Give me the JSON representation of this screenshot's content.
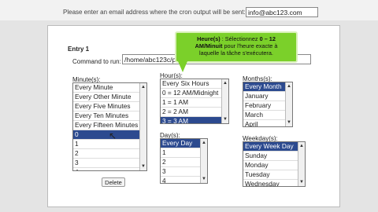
{
  "email": {
    "label": "Please enter an email address where the cron output will be sent:",
    "value": "info@abc123.com"
  },
  "entry": {
    "title": "Entry 1",
    "command_label": "Command to run:",
    "command_value": "/home/abc123c/pi"
  },
  "minute": {
    "label": "Minute(s):",
    "items": [
      "Every Minute",
      "Every Other Minute",
      "Every Five Minutes",
      "Every Ten Minutes",
      "Every Fifteen Minutes",
      "0",
      "1",
      "2",
      "3",
      "4"
    ],
    "selected": "0"
  },
  "hour": {
    "label": "Hour(s):",
    "items": [
      "Every Six Hours",
      "0 = 12 AM/Midnight",
      "1 = 1 AM",
      "2 = 2 AM",
      "3 = 3 AM"
    ],
    "selected": "3 = 3 AM"
  },
  "day": {
    "label": "Day(s):",
    "items": [
      "Every Day",
      "1",
      "2",
      "3",
      "4"
    ],
    "selected": "Every Day"
  },
  "month": {
    "label": "Months(s):",
    "items": [
      "Every Month",
      "January",
      "February",
      "March",
      "April"
    ],
    "selected": "Every Month"
  },
  "weekday": {
    "label": "Weekday(s):",
    "items": [
      "Every Week Day",
      "Sunday",
      "Monday",
      "Tuesday",
      "Wednesday"
    ],
    "selected": "Every Week Day"
  },
  "delete_label": "Delete",
  "tooltip": {
    "bold_line1": "Heure(s)",
    "text_line1": " : Sélectionnez ",
    "bold_range": "0 – 12",
    "bold_line2": "AM/Minuit",
    "text_line2": " pour l'heure exacte à",
    "line3": "laquelle la tâche s'exécutera."
  },
  "colors": {
    "selected_bg": "#2c4a8f",
    "tooltip_bg": "#7bd02a"
  }
}
